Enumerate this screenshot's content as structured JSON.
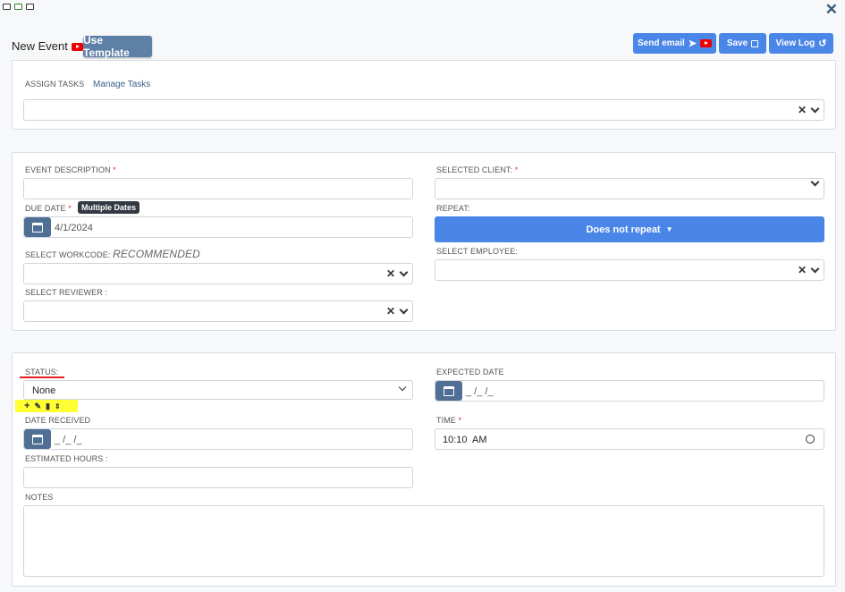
{
  "window": {
    "close_icon": "close-icon"
  },
  "header": {
    "title": "New Event",
    "use_template": "Use Template",
    "send_email": "Send email",
    "save": "Save",
    "view_log": "View Log"
  },
  "tasks": {
    "label": "ASSIGN TASKS",
    "manage_link": "Manage Tasks"
  },
  "event": {
    "description_label": "EVENT DESCRIPTION",
    "client_label": "SELECTED CLIENT:",
    "due_date_label": "DUE DATE",
    "multiple_dates_tooltip": "Multiple Dates",
    "due_date_value": "4/1/2024",
    "repeat_label": "REPEAT:",
    "repeat_value": "Does not repeat",
    "workcode_label": "SELECT WORKCODE:",
    "workcode_hint": "RECOMMENDED",
    "employee_label": "SELECT EMPLOYEE:",
    "reviewer_label": "SELECT REVIEWER :"
  },
  "status": {
    "status_label": "STATUS:",
    "status_value": "None",
    "expected_label": "EXPECTED DATE",
    "expected_value": "_ /_ /_",
    "date_received_label": "DATE RECEIVED",
    "date_received_value": "_ /_ /_",
    "time_label": "TIME",
    "time_value": "10:10  AM",
    "hours_label": "ESTIMATED HOURS :",
    "notes_label": "NOTES"
  },
  "colors": {
    "accent": "#4a86e8",
    "dark_button": "#4f6f94",
    "highlight": "#ffff33",
    "required": "#dd3333"
  }
}
